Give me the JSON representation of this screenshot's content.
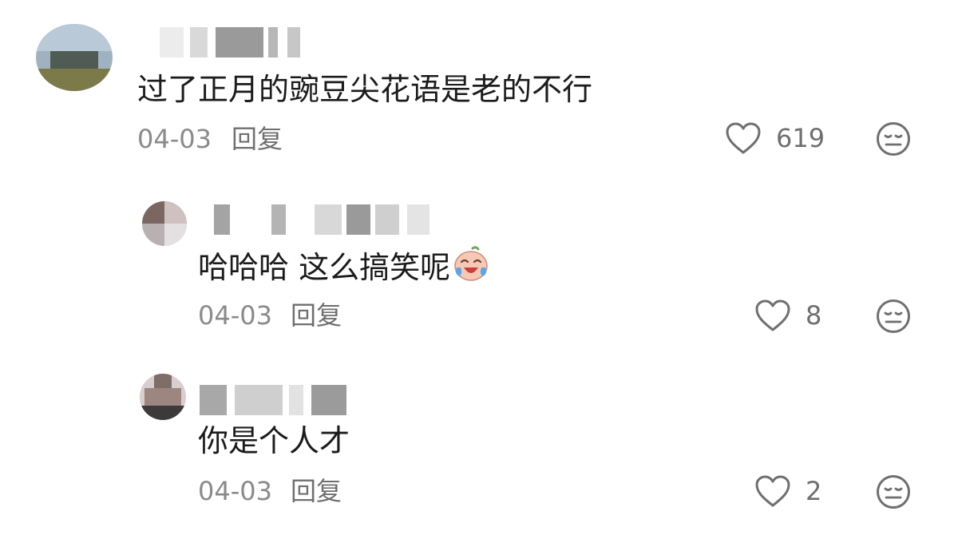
{
  "comments": [
    {
      "text": "过了正月的豌豆尖花语是老的不行",
      "date": "04-03",
      "reply_label": "回复",
      "likes": "619"
    },
    {
      "text": "哈哈哈 这么搞笑呢",
      "emoji": "laughing-tears-emoji",
      "date": "04-03",
      "reply_label": "回复",
      "likes": "8"
    },
    {
      "text": "你是个人才",
      "date": "04-03",
      "reply_label": "回复",
      "likes": "2"
    }
  ],
  "icons": {
    "like": "heart-outline-icon",
    "react": "neutral-face-icon"
  },
  "colors": {
    "text_primary": "#1b1b1b",
    "text_secondary": "#8a8a8a",
    "icon_stroke": "#6f6f6f"
  }
}
